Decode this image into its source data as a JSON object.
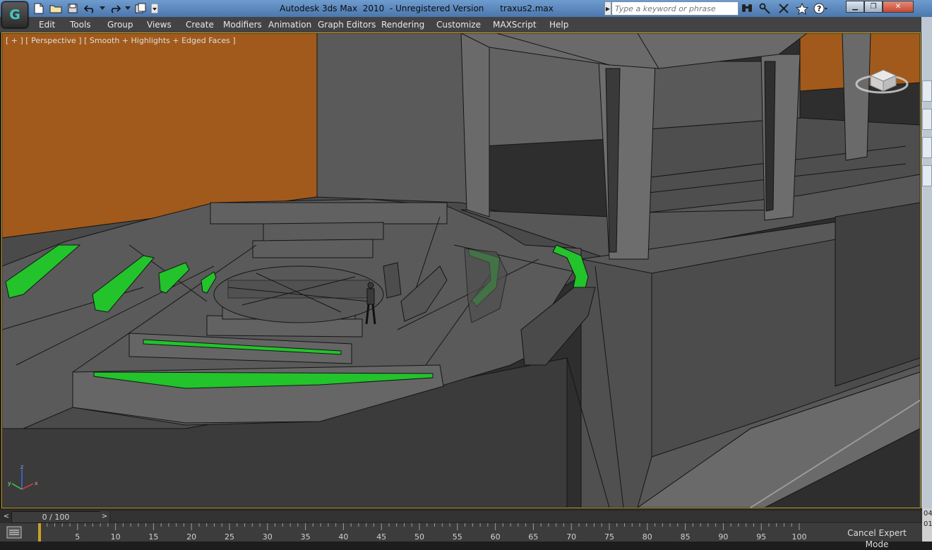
{
  "window": {
    "title": "Autodesk 3ds Max  2010  - Unregistered Version      traxus2.max",
    "app_logo": "3ds-max-logo",
    "controls": [
      "minimize",
      "restore",
      "close"
    ]
  },
  "quick_access": [
    "new-file-icon",
    "open-folder-icon",
    "save-icon",
    "undo-icon",
    "redo-icon",
    "project-folder-icon",
    "dropdown-arrow-icon"
  ],
  "search": {
    "placeholder": "Type a keyword or phrase",
    "value": ""
  },
  "info_tools": [
    "binoculars-icon",
    "key-tools-icon",
    "star-icon",
    "help-icon"
  ],
  "menu": {
    "items": [
      "Edit",
      "Tools",
      "Group",
      "Views",
      "Create",
      "Modifiers",
      "Animation",
      "Graph Editors",
      "Rendering",
      "Customize",
      "MAXScript",
      "Help"
    ]
  },
  "viewport": {
    "label": "[ + ] [ Perspective ] [ Smooth + Highlights + Edged Faces ]",
    "colors": {
      "background": "#2e2e2e",
      "floor": "#535353",
      "geometry": "#5f5f5f",
      "edge": "#151515",
      "orange_wall": "#a15a1b",
      "accent_green": "#22c32b",
      "selected_border": "#c9a227"
    },
    "viewcube_icon": "viewcube-icon",
    "axis_tripod": {
      "x": "x",
      "y": "y",
      "z": "z"
    }
  },
  "time_slider": {
    "frame": "0 / 100",
    "prev_icon": "chevron-left-icon",
    "next_icon": "chevron-right-icon"
  },
  "trackbar": {
    "icon": "trackbar-filter-icon",
    "ticks": [
      5,
      10,
      15,
      20,
      25,
      30,
      35,
      40,
      45,
      50,
      55,
      60,
      65,
      70,
      75,
      80,
      85,
      90,
      95,
      100
    ],
    "range": [
      0,
      100
    ],
    "current": 0
  },
  "status": {
    "expert_mode": "Cancel Expert Mode",
    "edge_text": [
      "04",
      "01,"
    ]
  }
}
